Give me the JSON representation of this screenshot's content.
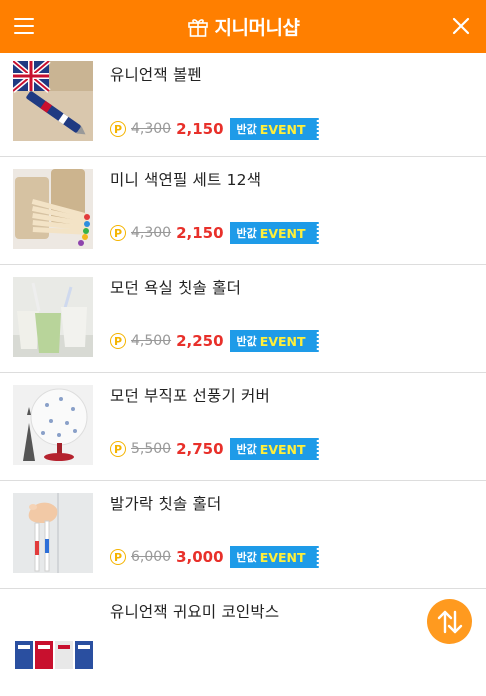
{
  "header": {
    "title": "지니머니샵",
    "menu_icon": "hamburger-menu-icon",
    "gift_icon": "gift-icon",
    "close_icon": "close-icon",
    "background_color": "#ff7f00"
  },
  "products": [
    {
      "name": "유니언잭 볼펜",
      "coin_symbol": "P",
      "original_price": "4,300",
      "sale_price": "2,150",
      "badge_prefix": "반값",
      "badge_label": "EVENT"
    },
    {
      "name": "미니 색연필 세트 12색",
      "coin_symbol": "P",
      "original_price": "4,300",
      "sale_price": "2,150",
      "badge_prefix": "반값",
      "badge_label": "EVENT"
    },
    {
      "name": "모던 욕실 칫솔 홀더",
      "coin_symbol": "P",
      "original_price": "4,500",
      "sale_price": "2,250",
      "badge_prefix": "반값",
      "badge_label": "EVENT"
    },
    {
      "name": "모던 부직포 선풍기 커버",
      "coin_symbol": "P",
      "original_price": "5,500",
      "sale_price": "2,750",
      "badge_prefix": "반값",
      "badge_label": "EVENT"
    },
    {
      "name": "발가락 칫솔 홀더",
      "coin_symbol": "P",
      "original_price": "6,000",
      "sale_price": "3,000",
      "badge_prefix": "반값",
      "badge_label": "EVENT"
    },
    {
      "name": "유니언잭 귀요미 코인박스"
    }
  ],
  "colors": {
    "sale_price": "#e8302a",
    "badge_background": "#1e9be8",
    "badge_text": "#ffef3a",
    "coin": "#f5b400",
    "fab_background": "#ff9a1f"
  },
  "scroll_button_icon": "scroll-up-down-icon"
}
